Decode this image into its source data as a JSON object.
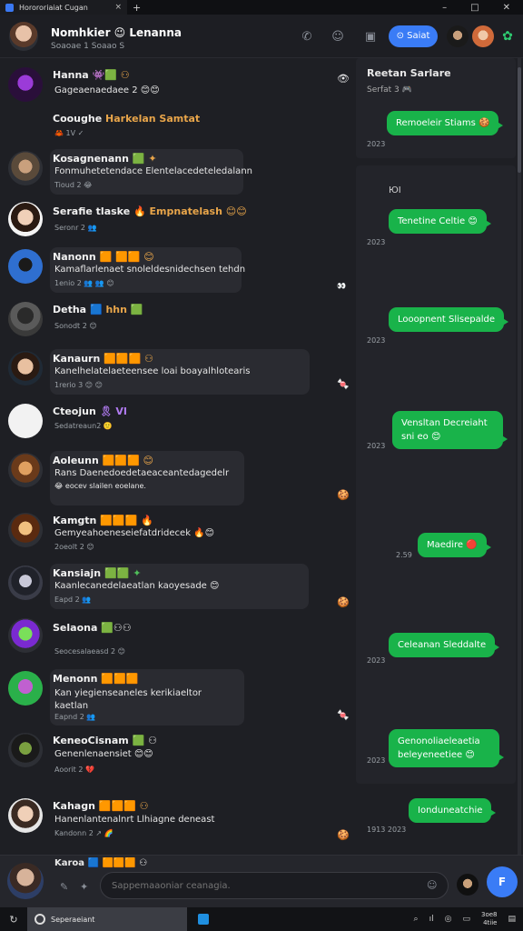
{
  "titlebar": {
    "tab_title": "Horororiaiat Cugan",
    "close_glyph": "×",
    "new_tab_glyph": "+",
    "min_glyph": "–",
    "max_glyph": "□",
    "win_close_glyph": "✕"
  },
  "header": {
    "name": "Nomhkier 😉 Lenanna",
    "subtitle": "Soaoae 1 Soaao S",
    "button_label": "⊙ Saiat",
    "phone_icon": "phone-icon",
    "emoji_icon": "smile-icon",
    "video_icon": "camera-icon"
  },
  "feed": [
    {
      "name": "Hanna",
      "tag": "👾🟩 ⚇",
      "text": "Gageaenaedaee 2 😊😊",
      "meta": "",
      "react": "👁"
    },
    {
      "name": "Cooughe",
      "tag": "Harkelan Samtat",
      "text": "",
      "meta": "🦀 1V  ✓",
      "react": ""
    },
    {
      "name": "Kosagnenann",
      "tag": "🟩 ✦",
      "text": "Fonmuhetetendace Elentelacedeteledalann",
      "meta": "Tioud 2 😂",
      "react": ""
    },
    {
      "name": "Serafie tlaske",
      "tag": "🔥 Empnatelash 😊😊",
      "text": "",
      "meta": "Seronr 2 👥",
      "react": ""
    },
    {
      "name": "Nanonn",
      "tag": "🟧 🟧🟧 😊",
      "text": "Kamaflarlenaet snoleldesnidechsen tehdn",
      "meta": "1enio 2 👥 👥 😊",
      "react": "👀"
    },
    {
      "name": "Detha",
      "tag": "🟦 hhn 🟩",
      "text": "",
      "meta": "Sonodt 2 😊",
      "react": ""
    },
    {
      "name": "Kanaurn",
      "tag": "🟧🟧🟧 ⚇",
      "text": "Kanelhelatelaeteensee loai boayalhlotearis",
      "meta": "1rerio 3 😊 😊",
      "react": "🍬"
    },
    {
      "name": "Cteojun",
      "tag": "🎗 VI",
      "text": "",
      "meta": "Sedatreaun2 🙂",
      "react": ""
    },
    {
      "name": "Aoleunn",
      "tag": "🟧🟧🟧 😊",
      "text": "Rans Daenedoedetaeaceantedagedelr",
      "meta": "😂 eocev slailen eoelane.",
      "react": "🍪"
    },
    {
      "name": "Kamgtn",
      "tag": "🟧🟧🟧 🔥",
      "text": "Gemyeahoeneseiefatdridecek 🔥😊",
      "meta": "2oeolt 2 😊",
      "react": ""
    },
    {
      "name": "Kansiajn",
      "tag": "🟩🟩 ✦",
      "text": "Kaanlecanedelaeatlan kaoyesade 😊",
      "meta": "Eapd 2 👥",
      "react": "🍪"
    },
    {
      "name": "Selaona",
      "tag": "🟩⚇⚇",
      "text": "",
      "meta": "Seocesalaeasd 2 😊",
      "react": ""
    },
    {
      "name": "Menonn",
      "tag": "🟧🟧🟧",
      "text": "Kan yiegienseaneles kerikiaeltor kaetlan",
      "meta": "Eapnd 2 👥",
      "react": "🍬"
    },
    {
      "name": "KeneoCisnam",
      "tag": "🟩 ⚇",
      "text": "Genenlenaensiet 😊😊",
      "meta": "Aoorit 2 💔",
      "react": ""
    },
    {
      "name": "Kahagn",
      "tag": "🟧🟧🟧 ⚇",
      "text": "Hanenlantenalnrt Llhiagne deneast",
      "meta": "Kandonn 2 ↗ 🌈",
      "react": "🍪"
    }
  ],
  "panel": {
    "title": "Reetan Sarlare",
    "subtitle": "Serfat 3 🎮",
    "time1": "2023",
    "section2_label": "ЮI",
    "bubbles": [
      {
        "text": "Remoeleir Stiams 🍪",
        "time": "2023"
      },
      {
        "text": "Tenetine Celtie 😊",
        "time": "2023"
      },
      {
        "text": "Looopnent Slisepalde",
        "time": "2023"
      },
      {
        "text": "Vensltan Decreiaht sni eo 😊",
        "time": "2023"
      },
      {
        "text": "Maedire 🔴",
        "time": "2.59"
      },
      {
        "text": "Celeanan Sleddalte",
        "time": "2023"
      },
      {
        "text": "Genonoliaeleaetia beleyeneetiee 😊",
        "time": "2023"
      },
      {
        "text": "Ionduneatchie",
        "time": "1913 2023"
      }
    ]
  },
  "composer": {
    "name": "Karoa 🟦 🟧🟧🟧 ⚇",
    "placeholder": "Sappemaaoniar ceanagia.",
    "send_label": "F"
  },
  "taskbar": {
    "app_label": "Seperaeiant",
    "clock_time": "3oe8",
    "clock_date": "4tiie"
  },
  "colors": {
    "accent": "#3a7cf6",
    "bubble_green": "#19b34a",
    "bg": "#1e1f24"
  }
}
